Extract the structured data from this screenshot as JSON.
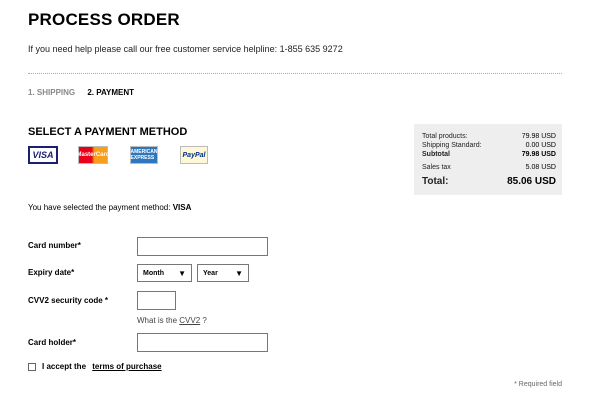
{
  "header": {
    "title": "PROCESS ORDER",
    "help_text": "If you need help please call our free customer service helpline: 1-855 635 9272"
  },
  "steps": [
    {
      "label": "1. SHIPPING",
      "active": false
    },
    {
      "label": "2. PAYMENT",
      "active": true
    }
  ],
  "payment": {
    "section_title": "SELECT A PAYMENT METHOD",
    "methods": [
      {
        "name": "VISA",
        "icon": "visa-card-icon"
      },
      {
        "name": "MasterCard",
        "icon": "mastercard-icon"
      },
      {
        "name": "AMERICAN EXPRESS",
        "icon": "amex-icon"
      },
      {
        "name": "PayPal",
        "icon": "paypal-icon"
      }
    ],
    "selected_prefix": "You have selected the payment method:",
    "selected_method": "VISA"
  },
  "summary": {
    "total_products_label": "Total products:",
    "total_products_value": "79.98 USD",
    "shipping_label": "Shipping  Standard:",
    "shipping_value": "0.00 USD",
    "subtotal_label": "Subtotal",
    "subtotal_value": "79.98 USD",
    "sales_tax_label": "Sales tax",
    "sales_tax_value": "5.08 USD",
    "total_label": "Total:",
    "total_value": "85.06 USD"
  },
  "form": {
    "card_number_label": "Card number*",
    "card_number_value": "",
    "expiry_label": "Expiry date*",
    "month_value": "Month",
    "year_value": "Year",
    "cvv_label": "CVV2 security code *",
    "cvv_value": "",
    "cvv_hint_prefix": "What is the",
    "cvv_hint_link": "CVV2",
    "cvv_hint_suffix": "?",
    "card_holder_label": "Card holder*",
    "card_holder_value": "",
    "accept_label": "I accept the",
    "terms_link": "terms of purchase",
    "required_note": "* Required field"
  }
}
